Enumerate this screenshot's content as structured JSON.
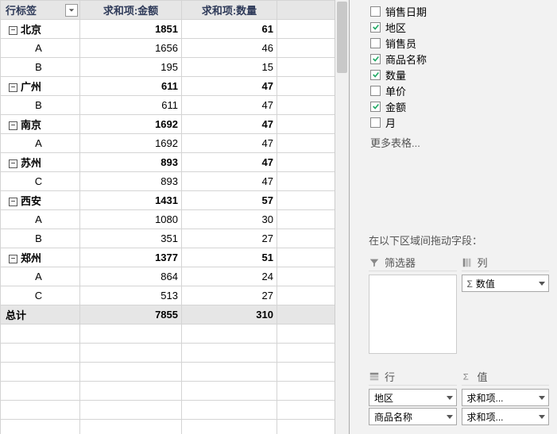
{
  "table": {
    "headers": {
      "row_label": "行标签",
      "sum_amount": "求和项:金额",
      "sum_qty": "求和项:数量"
    },
    "rows": [
      {
        "type": "group",
        "label": "北京",
        "amount": "1851",
        "qty": "61"
      },
      {
        "type": "leaf",
        "label": "A",
        "amount": "1656",
        "qty": "46"
      },
      {
        "type": "leaf",
        "label": "B",
        "amount": "195",
        "qty": "15"
      },
      {
        "type": "group",
        "label": "广州",
        "amount": "611",
        "qty": "47"
      },
      {
        "type": "leaf",
        "label": "B",
        "amount": "611",
        "qty": "47"
      },
      {
        "type": "group",
        "label": "南京",
        "amount": "1692",
        "qty": "47"
      },
      {
        "type": "leaf",
        "label": "A",
        "amount": "1692",
        "qty": "47"
      },
      {
        "type": "group",
        "label": "苏州",
        "amount": "893",
        "qty": "47"
      },
      {
        "type": "leaf",
        "label": "C",
        "amount": "893",
        "qty": "47"
      },
      {
        "type": "group",
        "label": "西安",
        "amount": "1431",
        "qty": "57"
      },
      {
        "type": "leaf",
        "label": "A",
        "amount": "1080",
        "qty": "30"
      },
      {
        "type": "leaf",
        "label": "B",
        "amount": "351",
        "qty": "27"
      },
      {
        "type": "group",
        "label": "郑州",
        "amount": "1377",
        "qty": "51"
      },
      {
        "type": "leaf",
        "label": "A",
        "amount": "864",
        "qty": "24"
      },
      {
        "type": "leaf",
        "label": "C",
        "amount": "513",
        "qty": "27"
      }
    ],
    "grand": {
      "label": "总计",
      "amount": "7855",
      "qty": "310"
    }
  },
  "fields": [
    {
      "label": "销售日期",
      "checked": false
    },
    {
      "label": "地区",
      "checked": true
    },
    {
      "label": "销售员",
      "checked": false
    },
    {
      "label": "商品名称",
      "checked": true
    },
    {
      "label": "数量",
      "checked": true
    },
    {
      "label": "单价",
      "checked": false
    },
    {
      "label": "金额",
      "checked": true
    },
    {
      "label": "月",
      "checked": false
    }
  ],
  "more_tables": "更多表格...",
  "drag_hint": "在以下区域间拖动字段：",
  "zones": {
    "filter": {
      "title": "筛选器"
    },
    "column": {
      "title": "列",
      "pills": [
        {
          "label": "数值",
          "sigma": true
        }
      ]
    },
    "row": {
      "title": "行",
      "pills": [
        {
          "label": "地区"
        },
        {
          "label": "商品名称"
        }
      ]
    },
    "value": {
      "title": "值",
      "pills": [
        {
          "label": "求和项..."
        },
        {
          "label": "求和项..."
        }
      ]
    }
  }
}
